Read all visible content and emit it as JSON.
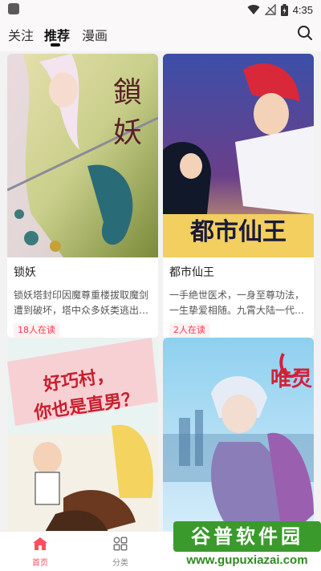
{
  "status_bar": {
    "time": "4:35"
  },
  "nav": {
    "tabs": [
      {
        "label": "关注",
        "active": false
      },
      {
        "label": "推荐",
        "active": true
      },
      {
        "label": "漫画",
        "active": false
      }
    ]
  },
  "cards": [
    {
      "title": "锁妖",
      "cover_text": "鎖妖",
      "desc": "锁妖塔封印因魔尊重楼拔取魔剑遭到破坏，塔中众多妖类逃出…",
      "readers": "18人在读"
    },
    {
      "title": "都市仙王",
      "cover_text": "都市仙王",
      "desc": "一手绝世医术，一身至尊功法，一生挚爱相随。九霄大陆一代…",
      "readers": "2人在读"
    },
    {
      "title": "",
      "cover_text": "好巧村，你也是直男？",
      "desc": "",
      "readers": ""
    },
    {
      "title": "",
      "cover_text": "唯灵",
      "desc": "",
      "readers": ""
    }
  ],
  "bottom_nav": {
    "items": [
      {
        "label": "首页",
        "active": true
      },
      {
        "label": "分类",
        "active": false
      }
    ]
  },
  "watermark": {
    "main": "谷普软件园",
    "url": "www.gupuxiazai.com"
  },
  "colors": {
    "accent": "#ff4f5f",
    "readers_bg": "#fff0f2",
    "watermark_green": "#3a9a2c"
  }
}
